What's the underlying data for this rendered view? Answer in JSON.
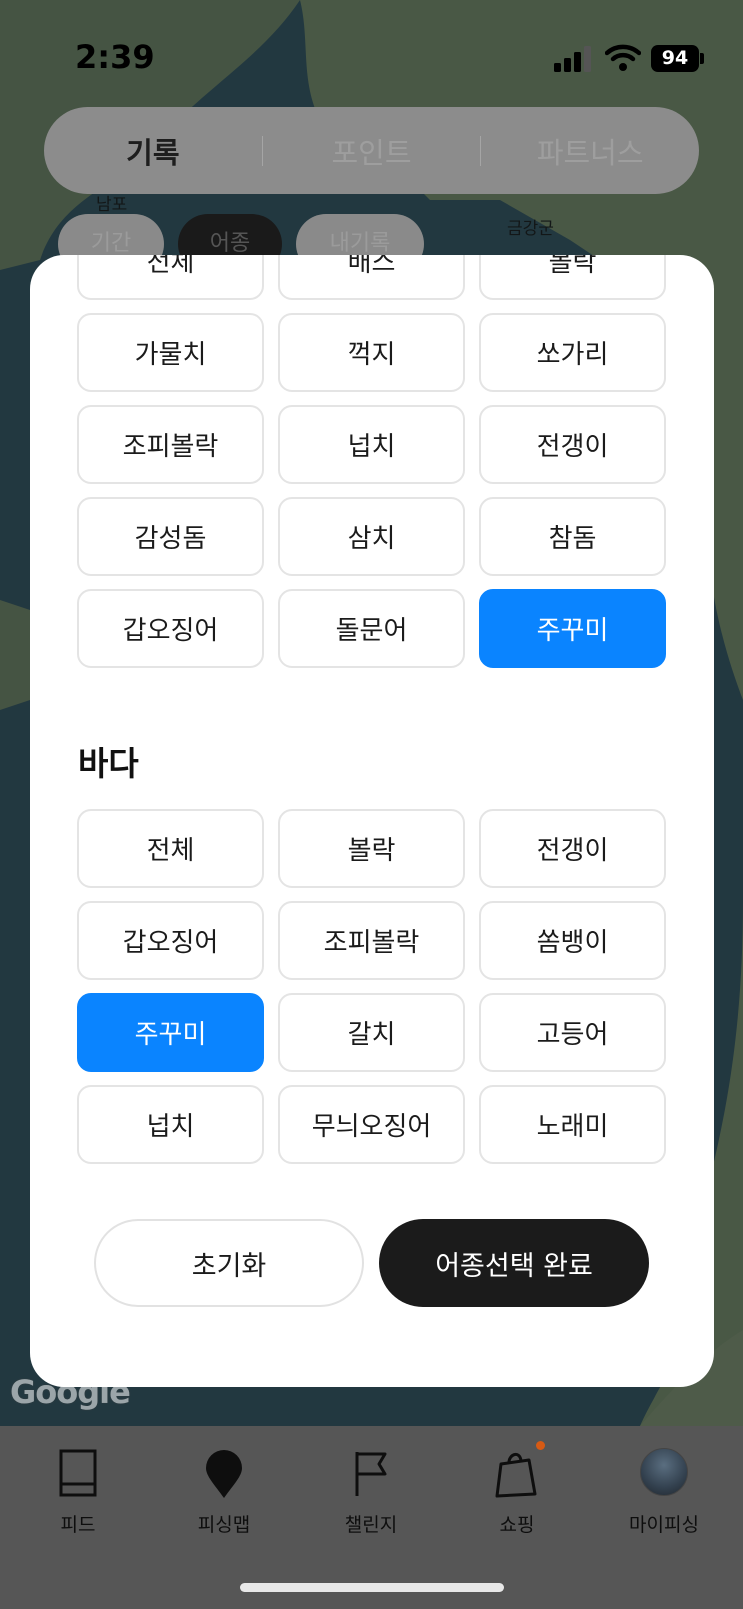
{
  "status_bar": {
    "time": "2:39",
    "battery": "94"
  },
  "top_tabs": [
    {
      "label": "기록",
      "active": true
    },
    {
      "label": "포인트",
      "active": false
    },
    {
      "label": "파트너스",
      "active": false
    }
  ],
  "map": {
    "labels": [
      "남포",
      "금강군"
    ],
    "attribution": "Google"
  },
  "filter_chips": [
    "기간",
    "어종",
    "내기록"
  ],
  "sheet": {
    "freshwater_options": [
      {
        "label": "전체",
        "selected": false
      },
      {
        "label": "배스",
        "selected": false
      },
      {
        "label": "볼락",
        "selected": false
      },
      {
        "label": "가물치",
        "selected": false
      },
      {
        "label": "꺽지",
        "selected": false
      },
      {
        "label": "쏘가리",
        "selected": false
      },
      {
        "label": "조피볼락",
        "selected": false
      },
      {
        "label": "넙치",
        "selected": false
      },
      {
        "label": "전갱이",
        "selected": false
      },
      {
        "label": "감성돔",
        "selected": false
      },
      {
        "label": "삼치",
        "selected": false
      },
      {
        "label": "참돔",
        "selected": false
      },
      {
        "label": "갑오징어",
        "selected": false
      },
      {
        "label": "돌문어",
        "selected": false
      },
      {
        "label": "주꾸미",
        "selected": true
      }
    ],
    "sea_title": "바다",
    "sea_options": [
      {
        "label": "전체",
        "selected": false
      },
      {
        "label": "볼락",
        "selected": false
      },
      {
        "label": "전갱이",
        "selected": false
      },
      {
        "label": "갑오징어",
        "selected": false
      },
      {
        "label": "조피볼락",
        "selected": false
      },
      {
        "label": "쏨뱅이",
        "selected": false
      },
      {
        "label": "주꾸미",
        "selected": true
      },
      {
        "label": "갈치",
        "selected": false
      },
      {
        "label": "고등어",
        "selected": false
      },
      {
        "label": "넙치",
        "selected": false
      },
      {
        "label": "무늬오징어",
        "selected": false
      },
      {
        "label": "노래미",
        "selected": false
      }
    ],
    "reset_label": "초기화",
    "done_label": "어종선택 완료"
  },
  "bottom_nav": [
    {
      "label": "피드",
      "icon": "feed-icon"
    },
    {
      "label": "피싱맵",
      "icon": "map-pin-icon"
    },
    {
      "label": "챌린지",
      "icon": "flag-icon"
    },
    {
      "label": "쇼핑",
      "icon": "shopping-bag-icon"
    },
    {
      "label": "마이피싱",
      "icon": "avatar"
    }
  ],
  "colors": {
    "accent": "#0a84ff",
    "dark_button": "#1b1b1b",
    "sheet": "#ffffff"
  }
}
